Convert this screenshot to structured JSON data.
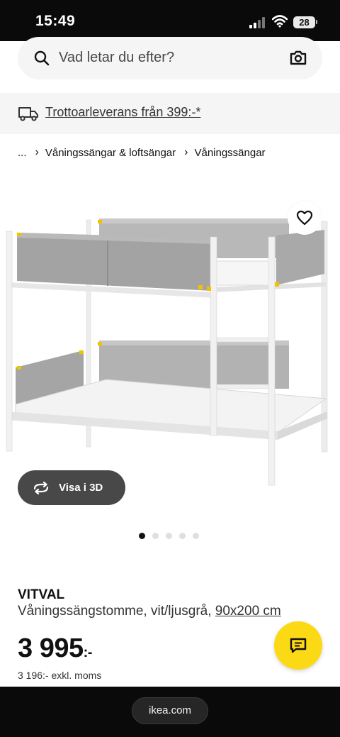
{
  "status_bar": {
    "time": "15:49",
    "battery": "28"
  },
  "search": {
    "placeholder": "Vad letar du efter?"
  },
  "delivery": {
    "text": "Trottoarleverans från 399:-*"
  },
  "breadcrumb": {
    "ellipsis": "...",
    "items": [
      "Våningssängar & loftsängar",
      "Våningssängar"
    ]
  },
  "gallery": {
    "view_3d_label": "Visa i 3D",
    "image_count": 5,
    "active_index": 0
  },
  "product": {
    "name": "VITVAL",
    "description": "Våningssängstomme, vit/ljusgrå,",
    "size": "90x200 cm",
    "price_main": "3 995",
    "price_suffix": ":-",
    "price_excl": "3 196:- exkl. moms"
  },
  "browser": {
    "url": "ikea.com"
  },
  "colors": {
    "accent_yellow": "#fbd914",
    "dark_pill": "#484848",
    "light_grey": "#f5f5f5"
  }
}
